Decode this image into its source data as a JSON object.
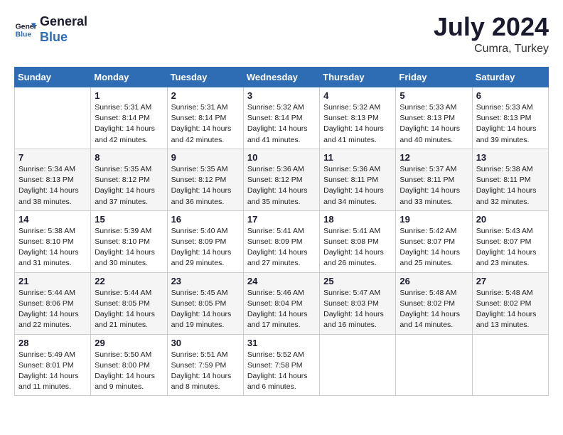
{
  "header": {
    "logo_line1": "General",
    "logo_line2": "Blue",
    "month_year": "July 2024",
    "location": "Cumra, Turkey"
  },
  "days_of_week": [
    "Sunday",
    "Monday",
    "Tuesday",
    "Wednesday",
    "Thursday",
    "Friday",
    "Saturday"
  ],
  "weeks": [
    [
      {
        "day": "",
        "info": ""
      },
      {
        "day": "1",
        "info": "Sunrise: 5:31 AM\nSunset: 8:14 PM\nDaylight: 14 hours\nand 42 minutes."
      },
      {
        "day": "2",
        "info": "Sunrise: 5:31 AM\nSunset: 8:14 PM\nDaylight: 14 hours\nand 42 minutes."
      },
      {
        "day": "3",
        "info": "Sunrise: 5:32 AM\nSunset: 8:14 PM\nDaylight: 14 hours\nand 41 minutes."
      },
      {
        "day": "4",
        "info": "Sunrise: 5:32 AM\nSunset: 8:13 PM\nDaylight: 14 hours\nand 41 minutes."
      },
      {
        "day": "5",
        "info": "Sunrise: 5:33 AM\nSunset: 8:13 PM\nDaylight: 14 hours\nand 40 minutes."
      },
      {
        "day": "6",
        "info": "Sunrise: 5:33 AM\nSunset: 8:13 PM\nDaylight: 14 hours\nand 39 minutes."
      }
    ],
    [
      {
        "day": "7",
        "info": "Sunrise: 5:34 AM\nSunset: 8:13 PM\nDaylight: 14 hours\nand 38 minutes."
      },
      {
        "day": "8",
        "info": "Sunrise: 5:35 AM\nSunset: 8:12 PM\nDaylight: 14 hours\nand 37 minutes."
      },
      {
        "day": "9",
        "info": "Sunrise: 5:35 AM\nSunset: 8:12 PM\nDaylight: 14 hours\nand 36 minutes."
      },
      {
        "day": "10",
        "info": "Sunrise: 5:36 AM\nSunset: 8:12 PM\nDaylight: 14 hours\nand 35 minutes."
      },
      {
        "day": "11",
        "info": "Sunrise: 5:36 AM\nSunset: 8:11 PM\nDaylight: 14 hours\nand 34 minutes."
      },
      {
        "day": "12",
        "info": "Sunrise: 5:37 AM\nSunset: 8:11 PM\nDaylight: 14 hours\nand 33 minutes."
      },
      {
        "day": "13",
        "info": "Sunrise: 5:38 AM\nSunset: 8:11 PM\nDaylight: 14 hours\nand 32 minutes."
      }
    ],
    [
      {
        "day": "14",
        "info": "Sunrise: 5:38 AM\nSunset: 8:10 PM\nDaylight: 14 hours\nand 31 minutes."
      },
      {
        "day": "15",
        "info": "Sunrise: 5:39 AM\nSunset: 8:10 PM\nDaylight: 14 hours\nand 30 minutes."
      },
      {
        "day": "16",
        "info": "Sunrise: 5:40 AM\nSunset: 8:09 PM\nDaylight: 14 hours\nand 29 minutes."
      },
      {
        "day": "17",
        "info": "Sunrise: 5:41 AM\nSunset: 8:09 PM\nDaylight: 14 hours\nand 27 minutes."
      },
      {
        "day": "18",
        "info": "Sunrise: 5:41 AM\nSunset: 8:08 PM\nDaylight: 14 hours\nand 26 minutes."
      },
      {
        "day": "19",
        "info": "Sunrise: 5:42 AM\nSunset: 8:07 PM\nDaylight: 14 hours\nand 25 minutes."
      },
      {
        "day": "20",
        "info": "Sunrise: 5:43 AM\nSunset: 8:07 PM\nDaylight: 14 hours\nand 23 minutes."
      }
    ],
    [
      {
        "day": "21",
        "info": "Sunrise: 5:44 AM\nSunset: 8:06 PM\nDaylight: 14 hours\nand 22 minutes."
      },
      {
        "day": "22",
        "info": "Sunrise: 5:44 AM\nSunset: 8:05 PM\nDaylight: 14 hours\nand 21 minutes."
      },
      {
        "day": "23",
        "info": "Sunrise: 5:45 AM\nSunset: 8:05 PM\nDaylight: 14 hours\nand 19 minutes."
      },
      {
        "day": "24",
        "info": "Sunrise: 5:46 AM\nSunset: 8:04 PM\nDaylight: 14 hours\nand 17 minutes."
      },
      {
        "day": "25",
        "info": "Sunrise: 5:47 AM\nSunset: 8:03 PM\nDaylight: 14 hours\nand 16 minutes."
      },
      {
        "day": "26",
        "info": "Sunrise: 5:48 AM\nSunset: 8:02 PM\nDaylight: 14 hours\nand 14 minutes."
      },
      {
        "day": "27",
        "info": "Sunrise: 5:48 AM\nSunset: 8:02 PM\nDaylight: 14 hours\nand 13 minutes."
      }
    ],
    [
      {
        "day": "28",
        "info": "Sunrise: 5:49 AM\nSunset: 8:01 PM\nDaylight: 14 hours\nand 11 minutes."
      },
      {
        "day": "29",
        "info": "Sunrise: 5:50 AM\nSunset: 8:00 PM\nDaylight: 14 hours\nand 9 minutes."
      },
      {
        "day": "30",
        "info": "Sunrise: 5:51 AM\nSunset: 7:59 PM\nDaylight: 14 hours\nand 8 minutes."
      },
      {
        "day": "31",
        "info": "Sunrise: 5:52 AM\nSunset: 7:58 PM\nDaylight: 14 hours\nand 6 minutes."
      },
      {
        "day": "",
        "info": ""
      },
      {
        "day": "",
        "info": ""
      },
      {
        "day": "",
        "info": ""
      }
    ]
  ]
}
